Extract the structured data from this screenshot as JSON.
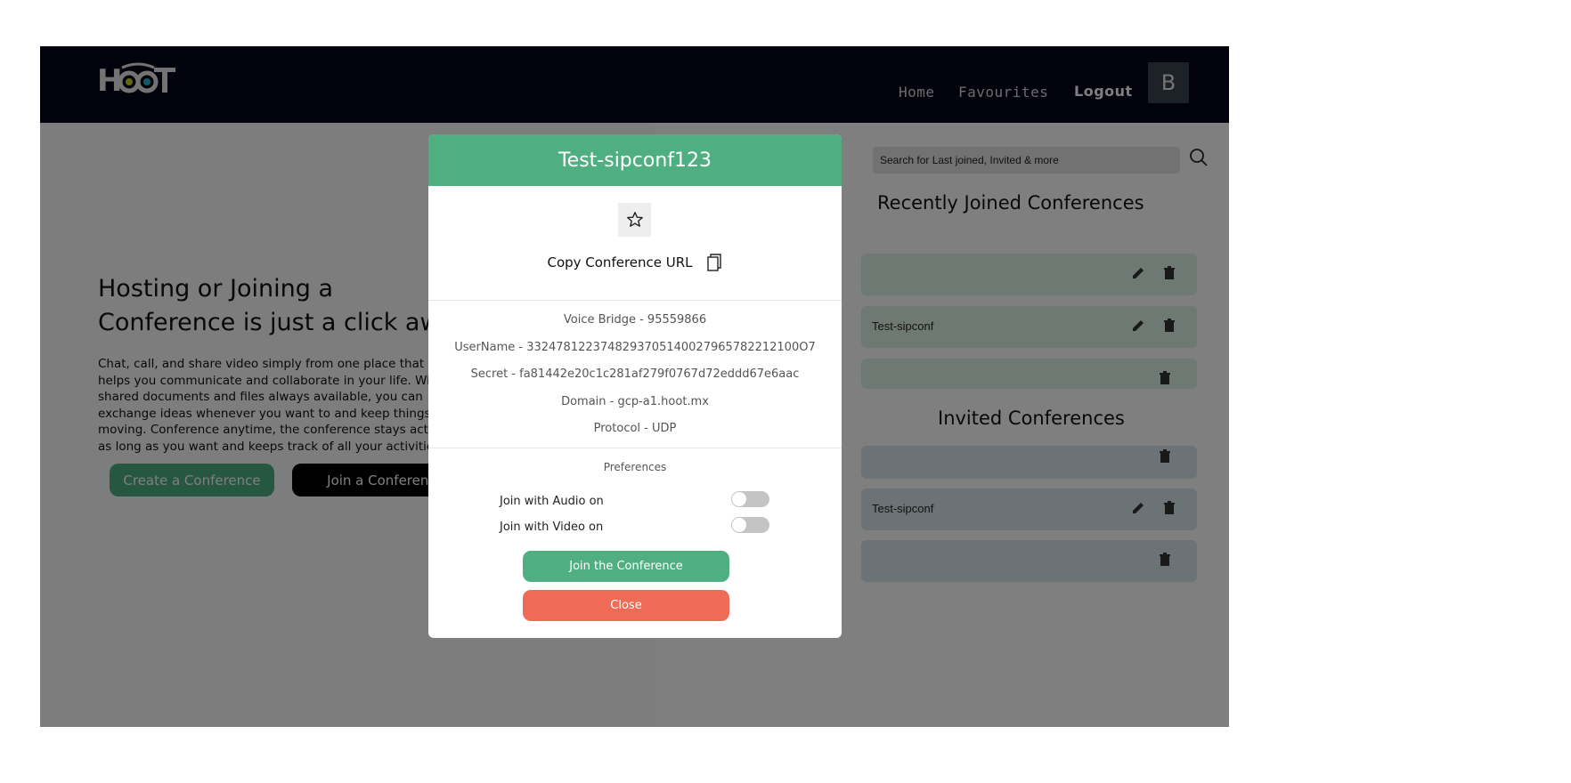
{
  "header": {
    "logo_text": "HOOT",
    "nav": {
      "home": "Home",
      "favourites": "Favourites",
      "logout": "Logout"
    },
    "avatar_initial": "B"
  },
  "hero": {
    "title": "Hosting or Joining a Conference is just a click away",
    "body": "Chat, call, and share video simply from one place that helps you communicate and collaborate in your life. With shared documents and files always available, you can exchange ideas whenever you want to and keep things moving. Conference anytime, the conference stays active as long as you want and keeps track of all your activities.",
    "create_button": "Create a Conference",
    "join_button": "Join a Conference"
  },
  "search": {
    "placeholder": "Search for Last joined, Invited & more"
  },
  "recent": {
    "title": "Recently Joined Conferences",
    "items": [
      {
        "name": ""
      },
      {
        "name": "Test-sipconf"
      },
      {
        "name": ""
      }
    ]
  },
  "invited": {
    "title": "Invited Conferences",
    "items": [
      {
        "name": ""
      },
      {
        "name": "Test-sipconf"
      },
      {
        "name": ""
      }
    ]
  },
  "modal": {
    "title": "Test-sipconf123",
    "copy_label": "Copy Conference URL",
    "voice_bridge": "Voice Bridge - 95559866",
    "username": "UserName - 3324781223748293705140027965782212100O7",
    "secret": "Secret - fa81442e20c1c281af279f0767d72eddd67e6aac",
    "domain": "Domain - gcp-a1.hoot.mx",
    "protocol": "Protocol - UDP",
    "preferences_title": "Preferences",
    "audio_label": "Join with Audio on",
    "video_label": "Join with Video on",
    "audio_on": false,
    "video_on": false,
    "join_button": "Join the Conference",
    "close_button": "Close"
  },
  "colors": {
    "topbar": "#05051b",
    "accent_green": "#4faf80",
    "close_red": "#ef6b55",
    "overlay": "rgba(0,0,0,0.5)"
  }
}
